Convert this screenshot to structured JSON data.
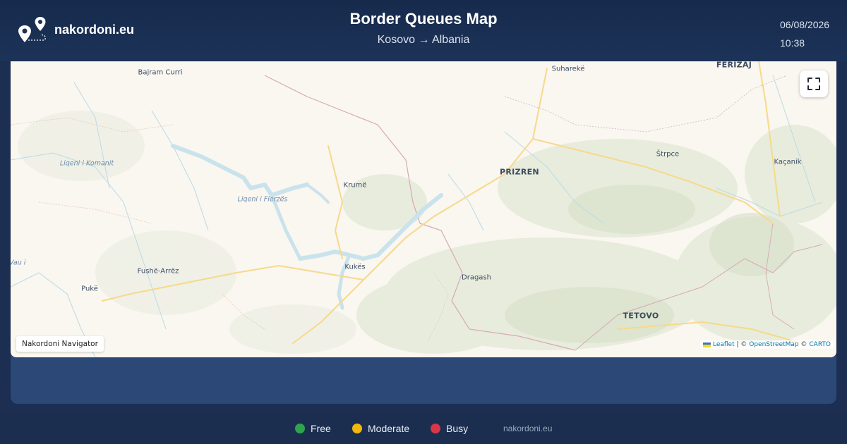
{
  "header": {
    "brand": "nakordoni.eu",
    "title": "Border Queues Map",
    "route": "Kosovo → Albania",
    "date": "06/08/2026",
    "time": "10:38"
  },
  "map": {
    "places": [
      {
        "name": "Bajram Curri",
        "kind": "town"
      },
      {
        "name": "Suharekë",
        "kind": "town"
      },
      {
        "name": "FERIZAJ",
        "kind": "city"
      },
      {
        "name": "Liqeni i Komanit",
        "kind": "water"
      },
      {
        "name": "Krumë",
        "kind": "town"
      },
      {
        "name": "PRIZREN",
        "kind": "city"
      },
      {
        "name": "Štrpce",
        "kind": "town"
      },
      {
        "name": "Kaçanik",
        "kind": "town"
      },
      {
        "name": "Liqeni i Fierzës",
        "kind": "water"
      },
      {
        "name": "Vau i",
        "kind": "water"
      },
      {
        "name": "Fushë-Arrëz",
        "kind": "town"
      },
      {
        "name": "Kukës",
        "kind": "town"
      },
      {
        "name": "Pukë",
        "kind": "town"
      },
      {
        "name": "Dragash",
        "kind": "town"
      },
      {
        "name": "TETOVO",
        "kind": "city"
      }
    ],
    "badge": "Nakordoni Navigator",
    "attribution": {
      "leaflet": "Leaflet",
      "sep1": " | © ",
      "osm": "OpenStreetMap",
      "sep2": " © ",
      "carto": "CARTO"
    },
    "fullscreen_icon": "expand-icon"
  },
  "legend": [
    {
      "label": "Free",
      "color": "#2ea44f"
    },
    {
      "label": "Moderate",
      "color": "#f0b90b"
    },
    {
      "label": "Busy",
      "color": "#dc3545"
    }
  ],
  "footer": {
    "site": "nakordoni.eu"
  },
  "colors": {
    "header_bg": "#162a4c",
    "panel_bg": "#2b4876",
    "map_bg": "#faf6f0",
    "water": "#c9e3ec",
    "road": "#f7d98a"
  }
}
